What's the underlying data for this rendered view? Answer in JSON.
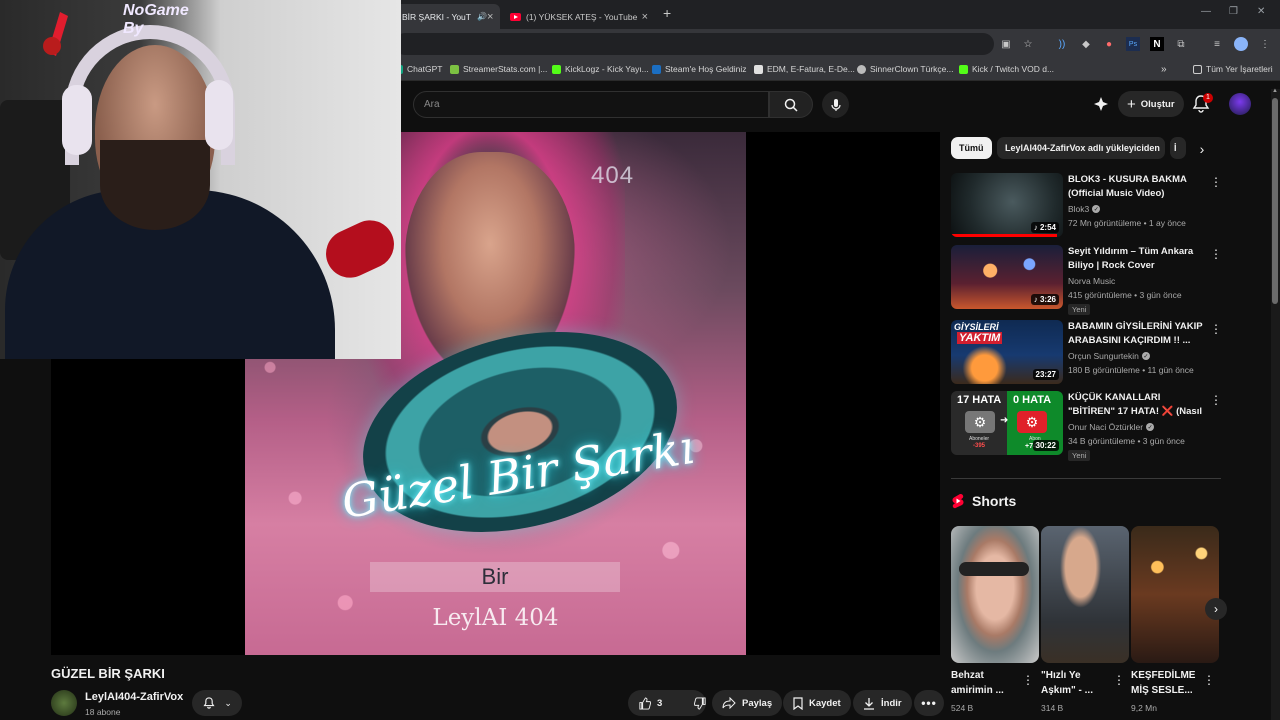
{
  "browser": {
    "tabs": [
      {
        "title": "BİR ŞARKI - YouT"
      },
      {
        "title": "(1) YÜKSEK ATEŞ - YouTube"
      }
    ],
    "new_tab": "+",
    "bookmarks": [
      {
        "label": "ChatGPT",
        "color": "#10a37f"
      },
      {
        "label": "StreamerStats.com |...",
        "color": "#7cc142"
      },
      {
        "label": "KickLogz - Kick Yayı...",
        "color": "#53fc18"
      },
      {
        "label": "Steam'e Hoş Geldiniz",
        "color": "#1b6ec2"
      },
      {
        "label": "EDM, E-Fatura, E-De...",
        "color": "#e0e0e0"
      },
      {
        "label": "SinnerClown Türkçe...",
        "color": "#bbbbbb"
      },
      {
        "label": "Kick / Twitch VOD d...",
        "color": "#53fc18"
      }
    ],
    "bookmarks_folder": "Tüm Yer İşaretleri"
  },
  "masthead": {
    "search_placeholder": "Ara",
    "create_label": "Oluştur",
    "notifications_count": "1"
  },
  "player": {
    "art_tag": "404",
    "song_script": "Güzel Bir Şarkı",
    "lyric_box": "Bir",
    "art_signature": "LeylAI 404"
  },
  "webcam": {
    "overlay_logo": "NoGame By"
  },
  "video": {
    "title": "GÜZEL BİR ŞARKI",
    "channel": "LeylAI404-ZafirVox",
    "subscribers": "18 abone",
    "likes": "3",
    "share_label": "Paylaş",
    "save_label": "Kaydet",
    "download_label": "İndir"
  },
  "chips": [
    {
      "label": "Tümü"
    },
    {
      "label": "LeylAI404-ZafirVox adlı yükleyiciden"
    },
    {
      "label": "İ"
    }
  ],
  "recommendations": [
    {
      "title": "BLOK3 - KUSURA BAKMA (Official Music Video)",
      "channel": "Blok3",
      "meta": "72 Mn görüntüleme • 1 ay önce",
      "duration": "2:54",
      "badge": "",
      "watched": 0.95
    },
    {
      "title": "Seyit Yıldırım – Tüm Ankara Biliyo | Rock Cover",
      "channel": "Norva Music",
      "meta": "415 görüntüleme • 3 gün önce",
      "duration": "3:26",
      "badge": "Yeni",
      "watched": 0
    },
    {
      "title": "BABAMIN GİYSİLERİNİ YAKIP ARABASINI KAÇIRDIM !! ...",
      "channel": "Orçun Sungurtekin",
      "meta": "180 B görüntüleme • 11 gün önce",
      "duration": "23:27",
      "badge": "",
      "watched": 0
    },
    {
      "title": "KÜÇÜK KANALLARI \"BİTİREN\" 17 HATA! ❌ (Nasıl YouTuber ...",
      "channel": "Onur Naci Öztürkler",
      "meta": "34 B görüntüleme • 3 gün önce",
      "duration": "30:22",
      "badge": "Yeni",
      "watched": 0
    }
  ],
  "thumb_texts": {
    "rec3_line1": "GİYSİLERİ",
    "rec3_line2": "YAKTIM",
    "rec4_left": "17 HATA",
    "rec4_right": "0 HATA",
    "rec4_left_sub": "Aboneler",
    "rec4_left_num": "-395",
    "rec4_right_sub": "Abon",
    "rec4_right_num": "+745"
  },
  "shorts": {
    "heading": "Shorts",
    "items": [
      {
        "title": "Behzat amirimin ...",
        "views": "524 B"
      },
      {
        "title": "\"Hızlı Ye Aşkım\" - ...",
        "views": "314 B"
      },
      {
        "title": "KEŞFEDİLME MİŞ SESLE...",
        "views": "9,2 Mn"
      }
    ]
  },
  "colors": {
    "accent": "#ff0000",
    "background": "#0f0f0f",
    "chip_active": "#f1f1f1"
  }
}
